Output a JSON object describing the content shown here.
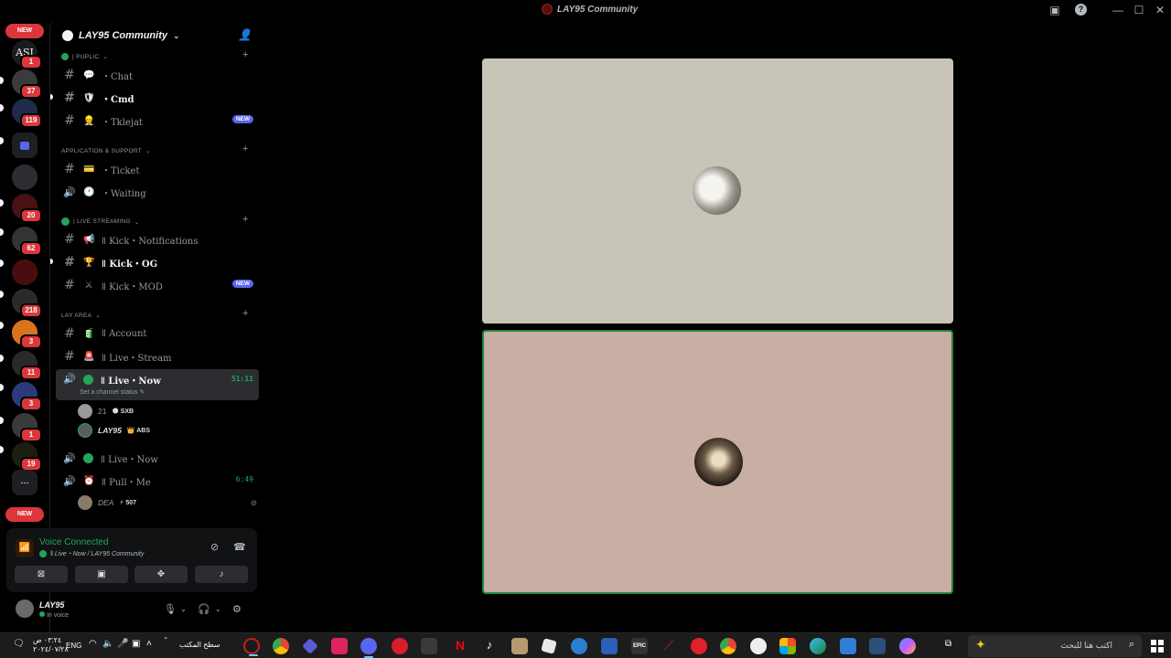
{
  "window": {
    "title": "LAY95 Community",
    "controls": {
      "minimize": "—",
      "maximize": "☐",
      "close": "✕",
      "inbox": "▣",
      "help": "?"
    }
  },
  "rail": {
    "new_label": "NEW",
    "new_bottom_label": "NEW",
    "servers": [
      {
        "label": "ASI",
        "badge": "1",
        "color": "#1b1b1b"
      },
      {
        "label": "",
        "badge": "37",
        "color": "#3b3b3b"
      },
      {
        "label": "",
        "badge": "119",
        "color": "#1e2b4a"
      },
      {
        "label": "",
        "badge": "",
        "color": "#2b2d31"
      },
      {
        "label": "",
        "badge": "20",
        "color": "#4a1212"
      },
      {
        "label": "",
        "badge": "62",
        "color": "#333333"
      },
      {
        "label": "",
        "badge": "",
        "color": "#4a0d0d"
      },
      {
        "label": "",
        "badge": "218",
        "color": "#2a2a2a"
      },
      {
        "label": "",
        "badge": "3",
        "color": "#d8751c"
      },
      {
        "label": "",
        "badge": "11",
        "color": "#2a2a2a"
      },
      {
        "label": "",
        "badge": "3",
        "color": "#2b3a7a"
      },
      {
        "label": "",
        "badge": "1",
        "color": "#3a3a3a"
      },
      {
        "label": "",
        "badge": "19",
        "color": "#1e1e10"
      }
    ],
    "more_label": "---"
  },
  "guild": {
    "name": "LAY95 Community",
    "categories": {
      "public": "| PUPLIC",
      "app_support": "APPLICATION & SUPPORT",
      "live_streaming": "| LIVE STREAMING",
      "lay_area": "LAY AREA"
    },
    "channels": {
      "chat": {
        "emoji": "💬",
        "name": "・Chat"
      },
      "cmd": {
        "emoji": "🛡",
        "name": "・Cmd"
      },
      "tklejat": {
        "emoji": "👷",
        "name": "・Tklejat",
        "tag": "NEW"
      },
      "ticket": {
        "emoji": "💳",
        "name": "・Ticket"
      },
      "waiting": {
        "emoji": "🕐",
        "name": "・Waiting"
      },
      "kick_notifications": {
        "emoji": "📢",
        "name": "ǁ Kick・Notifications"
      },
      "kick_og": {
        "emoji": "🏆",
        "name": "ǁ Kick・OG"
      },
      "kick_mod": {
        "emoji": "⚔",
        "name": "ǁ Kick・MOD",
        "tag": "NEW"
      },
      "account": {
        "emoji": "🧃",
        "name": "ǁ Account"
      },
      "live_stream": {
        "emoji": "🚨",
        "name": "ǁ Live・Stream"
      },
      "live_now_active": {
        "name": "ǁ Live・Now",
        "timer": "51:11",
        "status": "Set a channel status"
      },
      "live_now_2": {
        "name": "ǁ Live・Now"
      },
      "pull_me": {
        "emoji": "⏰",
        "name": "ǁ Pull・Me",
        "timer": "6:49"
      }
    },
    "voice_users": [
      {
        "name": "21",
        "tag": "🌑 SXB"
      },
      {
        "name": "LAY95",
        "tag": "👑 ABS"
      },
      {
        "name": "DEA",
        "tag": "⚡ 507"
      }
    ]
  },
  "voice_panel": {
    "status": "Voice Connected",
    "channel": "ǁ Live・Now / LAY95 Community"
  },
  "user": {
    "name": "LAY95",
    "status": "In voice"
  },
  "taskbar": {
    "time": "٠٣:٢٤ ص",
    "date": "٢٠٢٤/٠٧/٢٨",
    "lang": "ENG",
    "desktop_label": "سطح المكتب",
    "search_placeholder": "اكتب هنا للبحث"
  }
}
